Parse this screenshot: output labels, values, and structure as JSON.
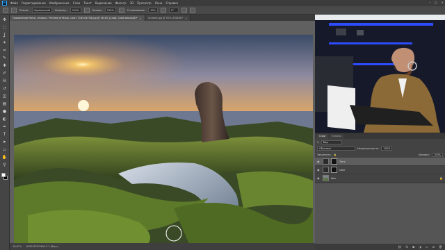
{
  "menubar": {
    "logo": "Ps",
    "items": [
      "Файл",
      "Редактирование",
      "Изображение",
      "Слои",
      "Текст",
      "Выделение",
      "Фильтр",
      "3D",
      "Просмотр",
      "Окно",
      "Справка"
    ],
    "window_controls": [
      "–",
      "□",
      "×"
    ]
  },
  "options_bar": {
    "mode_label": "Режим:",
    "mode_value": "Нормальный",
    "opacity_label": "Непрозр.:",
    "opacity_value": "100%",
    "flow_label": "Нажим:",
    "flow_value": "100%",
    "smoothing_label": "Сглаживание:",
    "smoothing_value": "10%",
    "angle_value": "0°"
  },
  "tabs": [
    {
      "label": "Проявление Мона, снимки - Preview of Mono, сжат 7165×4716.jpg @ 16.4% (Слой, Слой-маска/8)*",
      "active": true
    },
    {
      "label": "Untitled.jpg @ 50% (RGB/8)*",
      "active": false
    }
  ],
  "statusbar": {
    "zoom": "16,67%",
    "doc_info": "sRGB IEC61966-2.1 (8bpc)"
  },
  "layers_panel": {
    "tabs": [
      "Слои",
      "Каналы"
    ],
    "search_kind": "Вид",
    "blend_mode": "Обычные",
    "opacity_label": "Непрозрачность:",
    "opacity_value": "100%",
    "lock_label": "Закрепить:",
    "fill_label": "Заливка:",
    "fill_value": "100%",
    "layers": [
      {
        "name": "Тень",
        "selected": true,
        "has_mask": true,
        "locked": false
      },
      {
        "name": "Свет",
        "selected": false,
        "has_mask": true,
        "locked": false
      },
      {
        "name": "Фон",
        "selected": false,
        "has_mask": false,
        "locked": true
      }
    ],
    "footer_icons": [
      "link-icon",
      "fx-icon",
      "mask-icon",
      "adjustment-icon",
      "folder-icon",
      "new-layer-icon",
      "trash-icon"
    ]
  },
  "toolbar": {
    "tools": [
      "move-icon",
      "marquee-icon",
      "lasso-icon",
      "magic-wand-icon",
      "crop-icon",
      "eyedropper-icon",
      "healing-icon",
      "brush-icon",
      "stamp-icon",
      "history-brush-icon",
      "eraser-icon",
      "gradient-icon",
      "blur-icon",
      "dodge-icon",
      "pen-icon",
      "type-icon",
      "path-select-icon",
      "shape-icon",
      "hand-icon",
      "zoom-icon"
    ],
    "glyphs": [
      "✥",
      "⬚",
      "ʆ",
      "✶",
      "⌗",
      "✎",
      "✚",
      "✐",
      "⛁",
      "↺",
      "◫",
      "▤",
      "●",
      "◐",
      "✒",
      "T",
      "➤",
      "▭",
      "✋",
      "⚲"
    ],
    "fg_color": "#ffffff",
    "bg_color": "#000000"
  }
}
